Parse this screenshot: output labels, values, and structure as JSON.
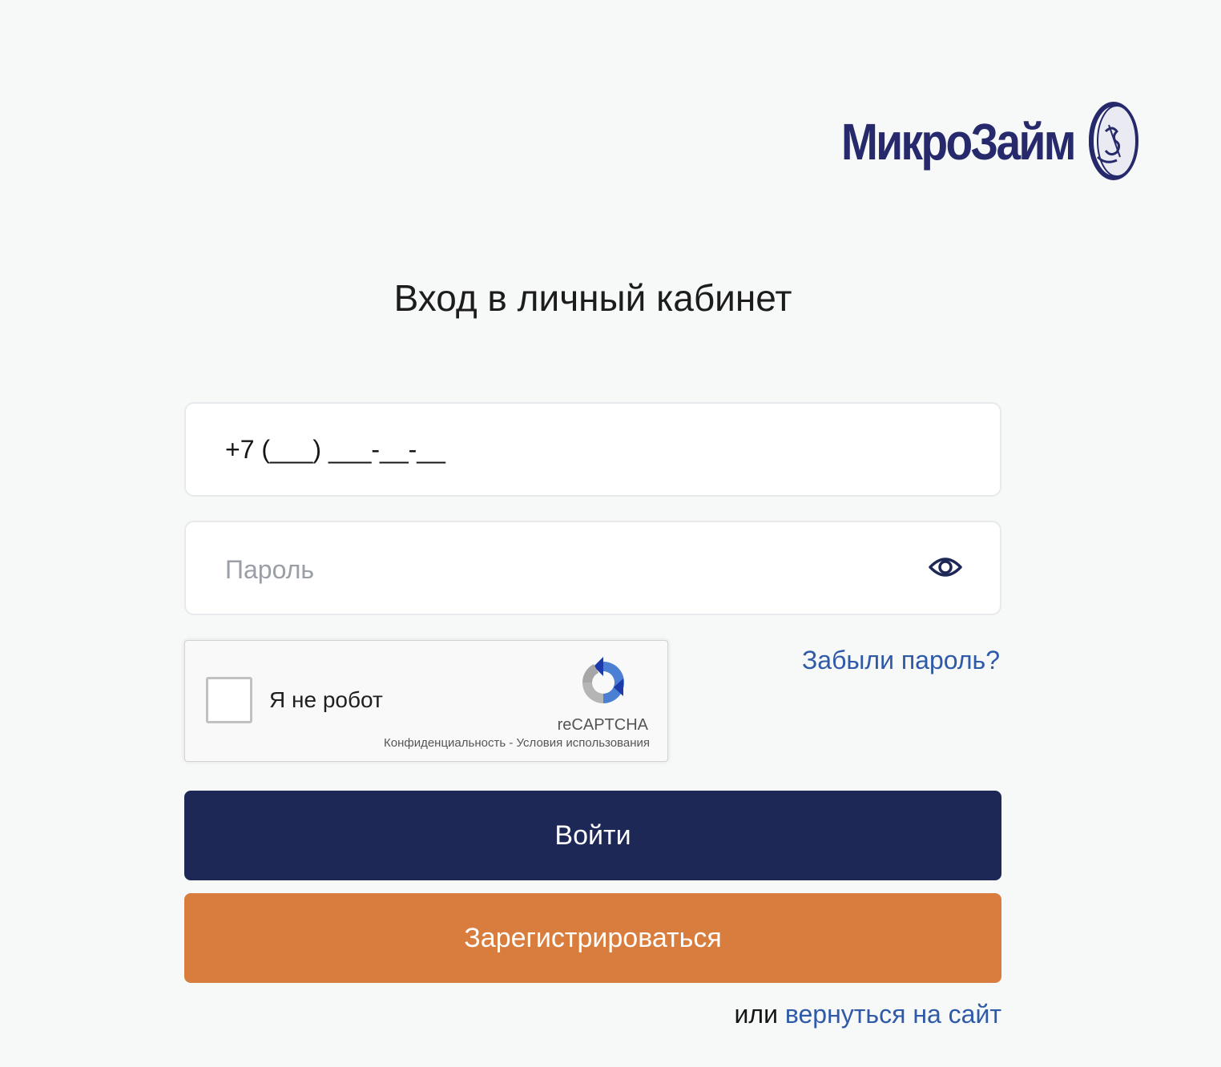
{
  "brand": {
    "logo_text": "МикроЗайм",
    "color": "#26296b"
  },
  "login": {
    "title": "Вход в личный кабинет",
    "phone_value": "+7 (___) ___-__-__",
    "password_placeholder": "Пароль",
    "password_toggle_icon": "eye-icon",
    "forgot_password_link": "Забыли пароль?"
  },
  "captcha": {
    "label": "Я не робот",
    "checked": false,
    "brand": "reCAPTCHA",
    "privacy_link": "Конфиденциальность",
    "separator": "-",
    "terms_link": "Условия использования"
  },
  "buttons": {
    "login_label": "Войти",
    "login_color": "#1d2856",
    "register_label": "Зарегистрироваться",
    "register_color": "#d87d3d"
  },
  "footer": {
    "or_text": "или",
    "back_link": "вернуться на сайт",
    "link_color": "#2f5aa8"
  }
}
